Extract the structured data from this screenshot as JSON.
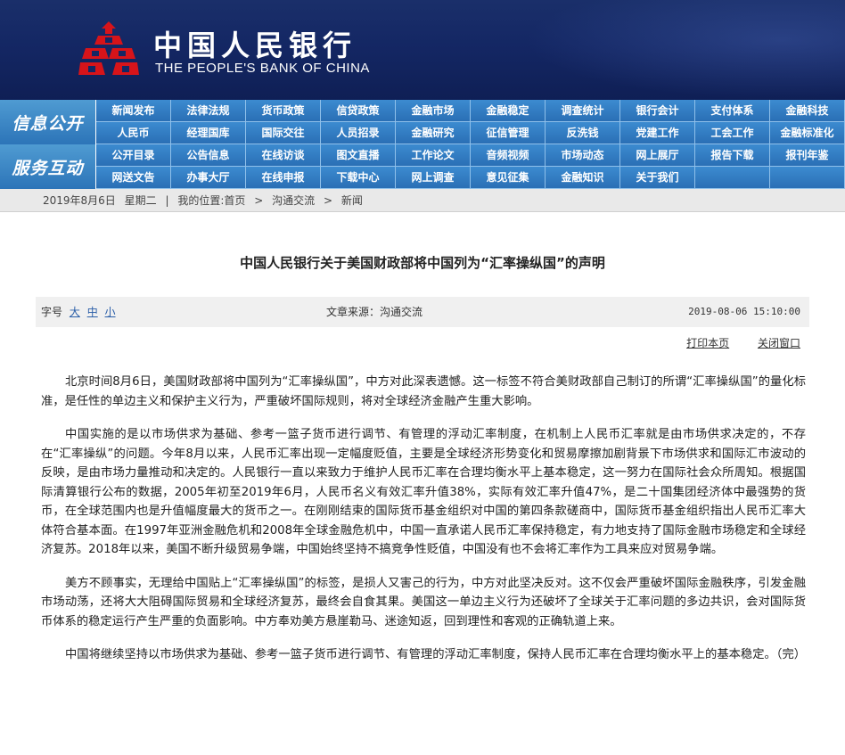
{
  "header": {
    "title_cn": "中国人民银行",
    "title_en": "THE PEOPLE'S BANK OF CHINA",
    "bg_color": "#142764",
    "logo_color": "#d7141a",
    "logo_icon": "pboc-logo-icon"
  },
  "nav": {
    "info_label": "信息公开",
    "service_label": "服务互动",
    "info_row1": [
      "新闻发布",
      "法律法规",
      "货币政策",
      "信贷政策",
      "金融市场",
      "金融稳定",
      "调查统计",
      "银行会计",
      "支付体系",
      "金融科技"
    ],
    "info_row2": [
      "人民币",
      "经理国库",
      "国际交往",
      "人员招录",
      "金融研究",
      "征信管理",
      "反洗钱",
      "党建工作",
      "工会工作",
      "金融标准化"
    ],
    "service_row1": [
      "公开目录",
      "公告信息",
      "在线访谈",
      "图文直播",
      "工作论文",
      "音频视频",
      "市场动态",
      "网上展厅",
      "报告下载",
      "报刊年鉴"
    ],
    "service_row2": [
      "网送文告",
      "办事大厅",
      "在线申报",
      "下载中心",
      "网上调查",
      "意见征集",
      "金融知识",
      "关于我们",
      "",
      ""
    ],
    "accent_color": "#2f7cc1"
  },
  "breadcrumb": {
    "date": "2019年8月6日",
    "weekday": "星期二",
    "sep": "|",
    "location_label": "我的位置:首页",
    "arrow1": ">",
    "crumb2": "沟通交流",
    "arrow2": ">",
    "crumb3": "新闻"
  },
  "article": {
    "title": "中国人民银行关于美国财政部将中国列为“汇率操纵国”的声明",
    "font_size_label": "字号",
    "size_large": "大",
    "size_medium": "中",
    "size_small": "小",
    "source": "文章来源：沟通交流",
    "datetime": "2019-08-06 15:10:00",
    "print_label": "打印本页",
    "close_label": "关闭窗口",
    "paragraphs": [
      "北京时间8月6日，美国财政部将中国列为“汇率操纵国”，中方对此深表遗憾。这一标签不符合美财政部自己制订的所谓“汇率操纵国”的量化标准，是任性的单边主义和保护主义行为，严重破坏国际规则，将对全球经济金融产生重大影响。",
      "中国实施的是以市场供求为基础、参考一篮子货币进行调节、有管理的浮动汇率制度，在机制上人民币汇率就是由市场供求决定的，不存在“汇率操纵”的问题。今年8月以来，人民币汇率出现一定幅度贬值，主要是全球经济形势变化和贸易摩擦加剧背景下市场供求和国际汇市波动的反映，是由市场力量推动和决定的。人民银行一直以来致力于维护人民币汇率在合理均衡水平上基本稳定，这一努力在国际社会众所周知。根据国际清算银行公布的数据，2005年初至2019年6月，人民币名义有效汇率升值38%，实际有效汇率升值47%，是二十国集团经济体中最强势的货币，在全球范围内也是升值幅度最大的货币之一。在刚刚结束的国际货币基金组织对中国的第四条款磋商中，国际货币基金组织指出人民币汇率大体符合基本面。在1997年亚洲金融危机和2008年全球金融危机中，中国一直承诺人民币汇率保持稳定，有力地支持了国际金融市场稳定和全球经济复苏。2018年以来，美国不断升级贸易争端，中国始终坚持不搞竞争性贬值，中国没有也不会将汇率作为工具来应对贸易争端。",
      "美方不顾事实，无理给中国贴上“汇率操纵国”的标签，是损人又害己的行为，中方对此坚决反对。这不仅会严重破坏国际金融秩序，引发金融市场动荡，还将大大阻碍国际贸易和全球经济复苏，最终会自食其果。美国这一单边主义行为还破坏了全球关于汇率问题的多边共识，会对国际货币体系的稳定运行产生严重的负面影响。中方奉劝美方悬崖勒马、迷途知返，回到理性和客观的正确轨道上来。",
      "中国将继续坚持以市场供求为基础、参考一篮子货币进行调节、有管理的浮动汇率制度，保持人民币汇率在合理均衡水平上的基本稳定。（完）"
    ]
  }
}
